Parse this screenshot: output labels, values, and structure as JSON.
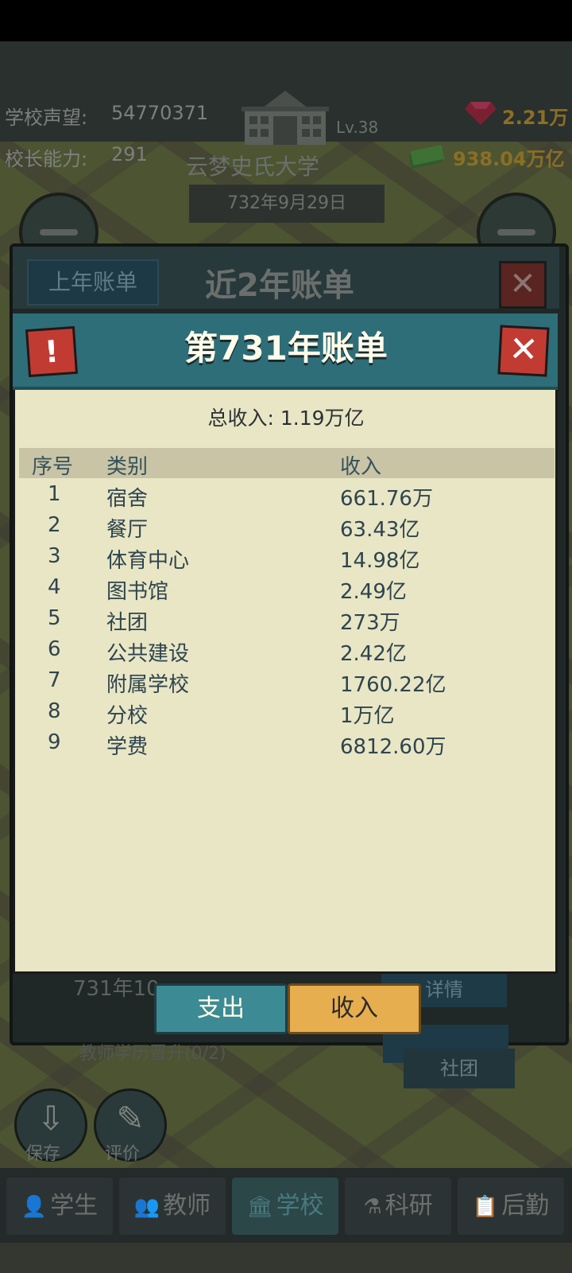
{
  "hud": {
    "reputation_label": "学校声望:",
    "reputation_value": "54770371",
    "ability_label": "校长能力:",
    "ability_value": "291",
    "level": "Lv.38",
    "school_name": "云梦史氏大学",
    "date": "732年9月29日",
    "gems": "2.21万",
    "money": "938.04万亿"
  },
  "back_dialog": {
    "tab_label": "上年账单",
    "title": "近2年账单",
    "row_text": "731年10",
    "detail_label": "详情",
    "task_text": "教师学历晋升(0/2)",
    "club_label": "社团"
  },
  "modal": {
    "title": "第731年账单",
    "total_label": "总收入:",
    "total_value": "1.19万亿",
    "headers": {
      "no": "序号",
      "category": "类别",
      "income": "收入"
    },
    "rows": [
      {
        "no": "1",
        "category": "宿舍",
        "income": "661.76万"
      },
      {
        "no": "2",
        "category": "餐厅",
        "income": "63.43亿"
      },
      {
        "no": "3",
        "category": "体育中心",
        "income": "14.98亿"
      },
      {
        "no": "4",
        "category": "图书馆",
        "income": "2.49亿"
      },
      {
        "no": "5",
        "category": "社团",
        "income": "273万"
      },
      {
        "no": "6",
        "category": "公共建设",
        "income": "2.42亿"
      },
      {
        "no": "7",
        "category": "附属学校",
        "income": "1760.22亿"
      },
      {
        "no": "8",
        "category": "分校",
        "income": "1万亿"
      },
      {
        "no": "9",
        "category": "学费",
        "income": "6812.60万"
      }
    ],
    "tab_expense": "支出",
    "tab_income": "收入"
  },
  "side_buttons": {
    "save": "保存",
    "review": "评价"
  },
  "nav": [
    {
      "label": "学生",
      "icon": "student-icon"
    },
    {
      "label": "教师",
      "icon": "teacher-icon"
    },
    {
      "label": "学校",
      "icon": "school-icon"
    },
    {
      "label": "科研",
      "icon": "flask-icon"
    },
    {
      "label": "后勤",
      "icon": "clipboard-icon"
    }
  ],
  "colors": {
    "accent": "#2e6e78",
    "income_tab": "#e6ae4f",
    "expense_tab": "#3c8a94",
    "close_red": "#c23b33"
  }
}
